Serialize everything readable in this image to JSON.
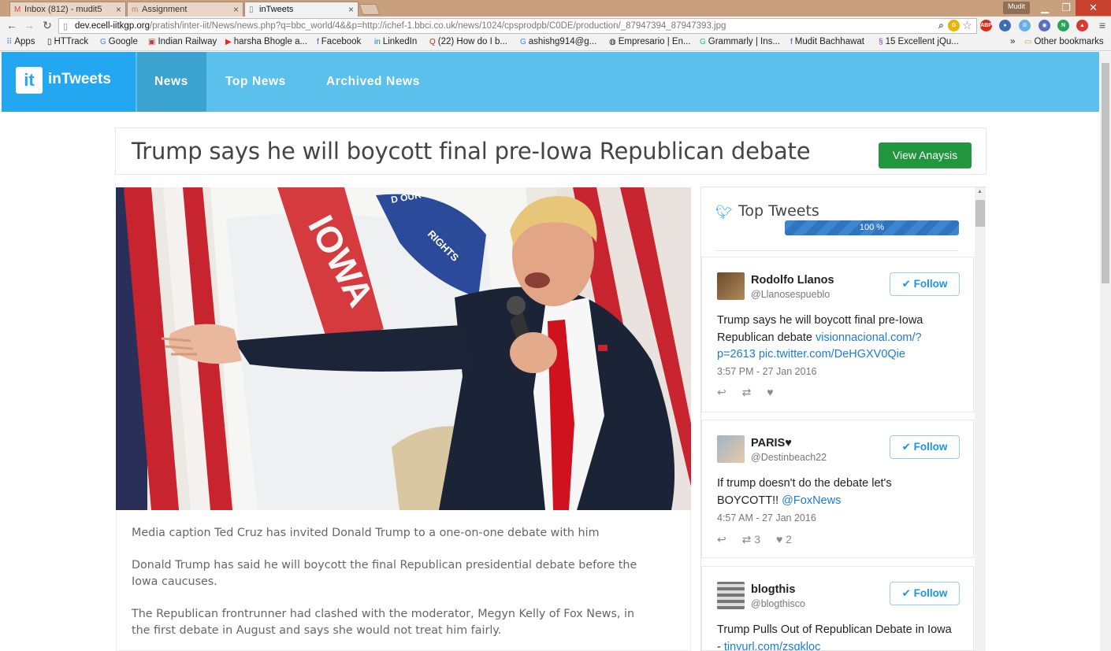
{
  "browser": {
    "tabs": [
      {
        "label": "Inbox (812) - mudit5",
        "icon": "gmail-icon"
      },
      {
        "label": "Assignment",
        "icon": "doc-icon"
      },
      {
        "label": "inTweets",
        "icon": "page-icon"
      }
    ],
    "profile": "Mudit",
    "url_host": "dev.ecell-iitkgp.org",
    "url_path": "/pratish/inter-iit/News/news.php?q=bbc_world/4&&p=http://ichef-1.bbci.co.uk/news/1024/cpsprodpb/C0DE/production/_87947394_87947393.jpg",
    "bookmarks": [
      {
        "label": "Apps",
        "icon": "apps-grid-icon"
      },
      {
        "label": "HTTrack",
        "icon": "page-icon"
      },
      {
        "label": "Google",
        "icon": "google-icon"
      },
      {
        "label": "Indian Railway",
        "icon": "train-icon"
      },
      {
        "label": "harsha Bhogle a...",
        "icon": "youtube-icon"
      },
      {
        "label": "Facebook",
        "icon": "facebook-icon"
      },
      {
        "label": "LinkedIn",
        "icon": "linkedin-icon"
      },
      {
        "label": "(22) How do I b...",
        "icon": "quora-icon"
      },
      {
        "label": "ashishg914@g...",
        "icon": "google-icon"
      },
      {
        "label": "Empresario | En...",
        "icon": "site-icon"
      },
      {
        "label": "Grammarly | Ins...",
        "icon": "grammarly-icon"
      },
      {
        "label": "Mudit Bachhawat",
        "icon": "facebook-icon"
      },
      {
        "label": "15 Excellent jQu...",
        "icon": "site-icon"
      }
    ],
    "overflow": "»",
    "other_bookmarks": "Other bookmarks"
  },
  "site": {
    "logo_mark": "it",
    "brand": "inTweets",
    "nav": [
      "News",
      "Top News",
      "Archived News"
    ],
    "active_nav": "News"
  },
  "article": {
    "headline": "Trump says he will boycott final pre-Iowa Republican debate",
    "view_button": "View Anaysis",
    "paragraphs": [
      "Media caption Ted Cruz has invited Donald Trump to a one-on-one debate with him",
      "Donald Trump has said he will boycott the final Republican presidential debate before the Iowa caucuses.",
      "The Republican frontrunner had clashed with the moderator, Megyn Kelly of Fox News, in the first debate in August and says she would not treat him fairly."
    ]
  },
  "tweets_panel": {
    "title": "Top Tweets",
    "progress_label": "100 %",
    "progress_value": 100,
    "follow_label": "Follow",
    "tweets": [
      {
        "name": "Rodolfo Llanos",
        "handle": "@Llanosespueblo",
        "text": "Trump says he will boycott final pre-Iowa Republican debate ",
        "link": "visionnacional.com/?p=2613 pic.twitter.com/DeHGXV0Qie",
        "time": "3:57 PM - 27 Jan 2016",
        "retweets": "",
        "likes": ""
      },
      {
        "name": "PARIS♥",
        "handle": "@Destinbeach22",
        "text": "If trump doesn't do the debate let's BOYCOTT!! ",
        "link": "@FoxNews",
        "time": "4:57 AM - 27 Jan 2016",
        "retweets": "3",
        "likes": "2"
      },
      {
        "name": "blogthis",
        "handle": "@blogthisco",
        "text": "Trump Pulls Out of Republican Debate in Iowa - ",
        "link": "tinyurl.com/zsqkloc",
        "time": "",
        "retweets": "",
        "likes": ""
      }
    ]
  },
  "colors": {
    "header_bg": "#5bc0eb",
    "brand_bg": "#22a7f0",
    "active_nav_bg": "#3aa3cf",
    "view_button": "#22963f",
    "twitter_blue": "#1da1f2",
    "link": "#1b7bd3"
  }
}
